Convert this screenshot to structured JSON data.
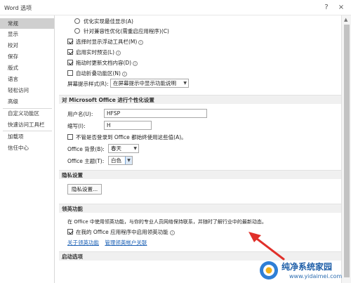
{
  "window": {
    "title": "Word 选项",
    "help": "?",
    "close": "×"
  },
  "sidebar": {
    "items": [
      {
        "label": "常规"
      },
      {
        "label": "显示"
      },
      {
        "label": "校对"
      },
      {
        "label": "保存"
      },
      {
        "label": "版式"
      },
      {
        "label": "语言"
      },
      {
        "label": "轻松访问"
      },
      {
        "label": "高级"
      },
      {
        "label": "自定义功能区"
      },
      {
        "label": "快速访问工具栏"
      },
      {
        "label": "加载项"
      },
      {
        "label": "信任中心"
      }
    ],
    "active_index": 0
  },
  "ui_options": {
    "radio_optimize_appearance": "优化实现最佳显示(A)",
    "radio_optimize_compat": "针对兼容性优化(需重启应用程序)(C)",
    "mini_toolbar": "选择时显示浮动工具栏(M)",
    "live_preview": "启用实时预览(L)",
    "update_doc_drag": "拖动时更新文档内容(D)",
    "collapse_ribbon": "自动折叠功能区(N)",
    "screentip_label": "屏幕提示样式(R):",
    "screentip_value": "在屏幕提示中显示功能说明"
  },
  "personalize": {
    "header": "对 Microsoft Office 进行个性化设置",
    "username_label": "用户名(U):",
    "username_value": "HFSP",
    "initials_label": "缩写(I):",
    "initials_value": "H",
    "always_use": "不管是否登录到 Office 都始终使用这些值(A)。",
    "background_label": "Office 背景(B):",
    "background_value": "春天",
    "theme_label": "Office 主题(T):",
    "theme_value": "白色"
  },
  "privacy": {
    "header": "隐私设置",
    "button": "隐私设置..."
  },
  "linkedin": {
    "header": "领英功能",
    "description": "在 Office 中使用领英功能，与你的专业人员网络保持联系，并随时了解行业中的最新动态。",
    "enable": "在我的 Office 应用程序中启用领英功能",
    "link_about": "关于领英功能",
    "link_manage": "管理领英帐户关联"
  },
  "startup": {
    "header": "启动选项"
  },
  "watermark": {
    "main": "纯净系统家园",
    "sub": "www.yidaimei.com"
  },
  "colors": {
    "accent": "#1a5fb4",
    "annotation_red": "#e0302a",
    "active_item": "#cfcfcf"
  }
}
